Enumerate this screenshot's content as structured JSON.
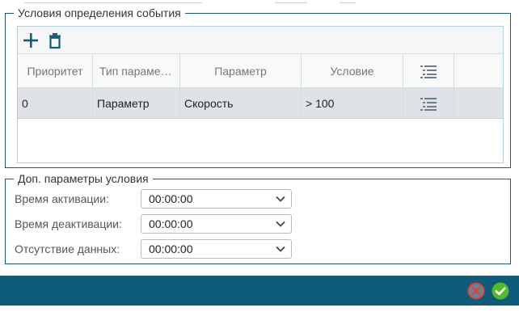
{
  "event_conditions": {
    "legend": "Условия определения события",
    "toolbar": {
      "add_icon": "plus-icon",
      "delete_icon": "trash-icon"
    },
    "columns": [
      "Приоритет",
      "Тип параме…",
      "Параметр",
      "Условие"
    ],
    "rows": [
      {
        "priority": "0",
        "type": "Параметр",
        "parameter": "Скорость",
        "condition": "> 100"
      }
    ]
  },
  "extra_params": {
    "legend": "Доп. параметры условия",
    "fields": [
      {
        "label": "Время активации:",
        "value": "00:00:00"
      },
      {
        "label": "Время деактивации:",
        "value": "00:00:00"
      },
      {
        "label": "Отсутствие данных:",
        "value": "00:00:00"
      }
    ]
  },
  "footer": {
    "cancel_icon": "cancel-circle-icon",
    "ok_icon": "check-circle-icon",
    "bar_color": "#0e5c7a"
  }
}
